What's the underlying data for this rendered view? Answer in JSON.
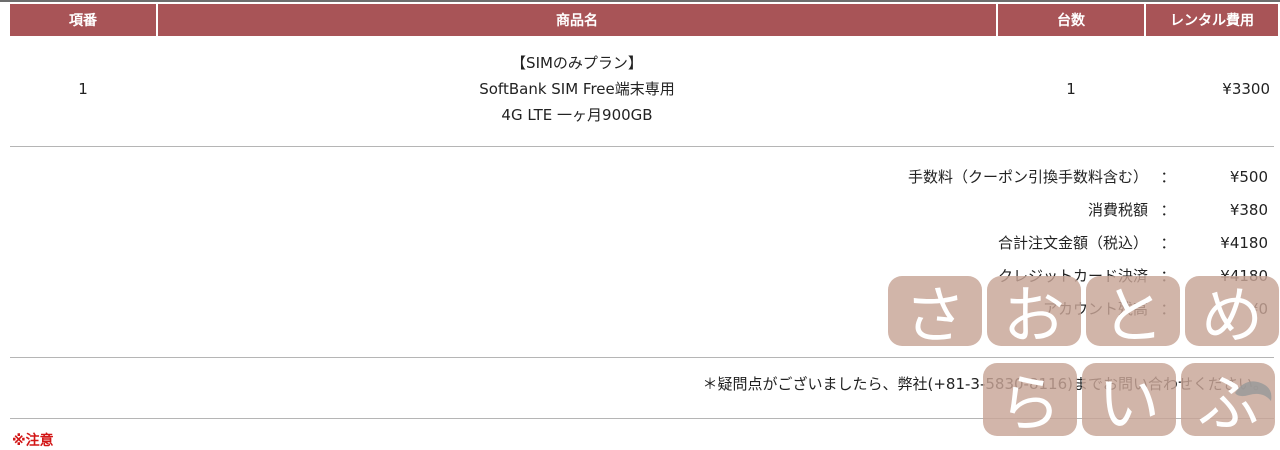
{
  "table": {
    "headers": {
      "item_no": "項番",
      "product_name": "商品名",
      "quantity": "台数",
      "rental_fee": "レンタル費用"
    },
    "rows": [
      {
        "item_no": "1",
        "product_lines": [
          "【SIMのみプラン】",
          "SoftBank SIM Free端末専用",
          "4G LTE 一ヶ月900GB"
        ],
        "quantity": "1",
        "rental_fee": "¥3300"
      }
    ]
  },
  "summary": [
    {
      "label": "手数料（クーポン引換手数料含む）",
      "colon": "：",
      "value": "¥500"
    },
    {
      "label": "消費税額",
      "colon": "：",
      "value": "¥380"
    },
    {
      "label": "合計注文金額（税込）",
      "colon": "：",
      "value": "¥4180"
    },
    {
      "label": "クレジットカード決済",
      "colon": "：",
      "value": "¥4180"
    },
    {
      "label": "アカウント残高",
      "colon": "：",
      "value": "¥0"
    }
  ],
  "note": "＊疑問点がございましたら、弊社(+81-3-5830-8116)までお問い合わせください。",
  "warning": "※注意",
  "watermark": {
    "row1": [
      "さ",
      "お",
      "と",
      "め"
    ],
    "row2": [
      "ら",
      "い",
      "ふ"
    ]
  },
  "colors": {
    "header_bg": "#a85457",
    "header_text": "#ffffff",
    "divider": "#b5b5b5",
    "warning": "#d21616",
    "watermark_tile": "#c8a597"
  }
}
